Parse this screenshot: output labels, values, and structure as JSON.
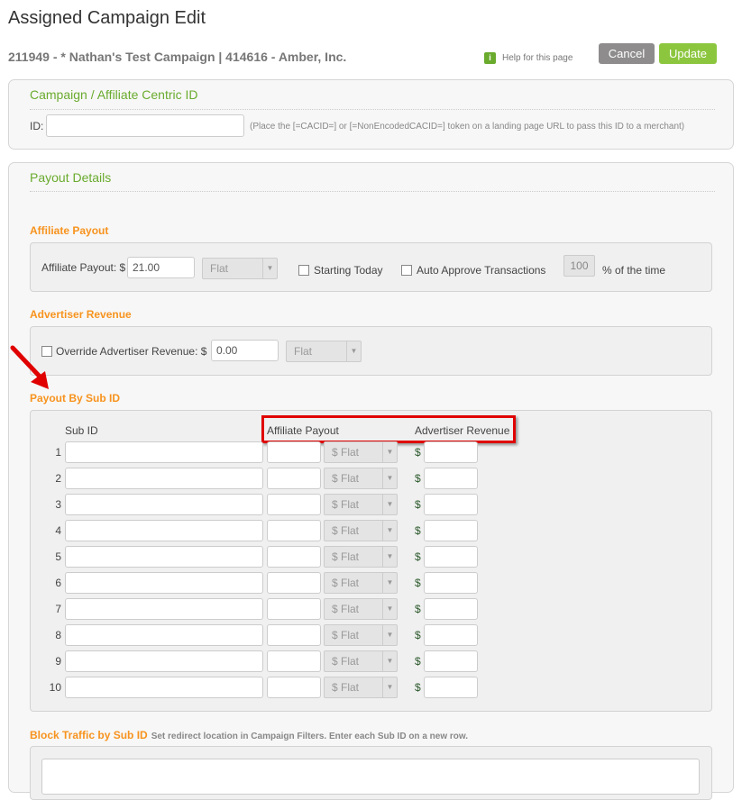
{
  "page": {
    "title": "Assigned Campaign Edit",
    "subtitle": "211949 - * Nathan's Test Campaign | 414616 - Amber, Inc.",
    "help": "Help for this page",
    "cancel": "Cancel",
    "update": "Update"
  },
  "centric": {
    "title": "Campaign / Affiliate Centric ID",
    "id_label": "ID:",
    "id_value": "",
    "hint": "(Place the [=CACID=] or [=NonEncodedCACID=] token on a landing page URL to pass this ID to a merchant)"
  },
  "payout": {
    "title": "Payout Details",
    "affiliate": {
      "heading": "Affiliate Payout",
      "label": "Affiliate Payout: $",
      "value": "21.00",
      "type": "Flat",
      "starting_today": "Starting Today",
      "auto_approve": "Auto Approve Transactions",
      "percent": "100",
      "percent_label": "% of the time"
    },
    "advertiser": {
      "heading": "Advertiser Revenue",
      "label": "Override Advertiser Revenue: $",
      "value": "0.00",
      "type": "Flat"
    },
    "subid": {
      "heading": "Payout By Sub ID",
      "col_subid": "Sub ID",
      "col_affiliate": "Affiliate Payout",
      "col_advertiser": "Advertiser Revenue",
      "type": "$ Flat",
      "currency": "$",
      "rows": [
        "1",
        "2",
        "3",
        "4",
        "5",
        "6",
        "7",
        "8",
        "9",
        "10"
      ]
    },
    "block": {
      "heading": "Block Traffic by Sub ID",
      "hint": "Set redirect location in Campaign Filters. Enter each Sub ID on a new row."
    }
  },
  "colors": {
    "accent_green": "#6aab2e",
    "orange": "#f7931e",
    "annotation_red": "#e00000"
  }
}
